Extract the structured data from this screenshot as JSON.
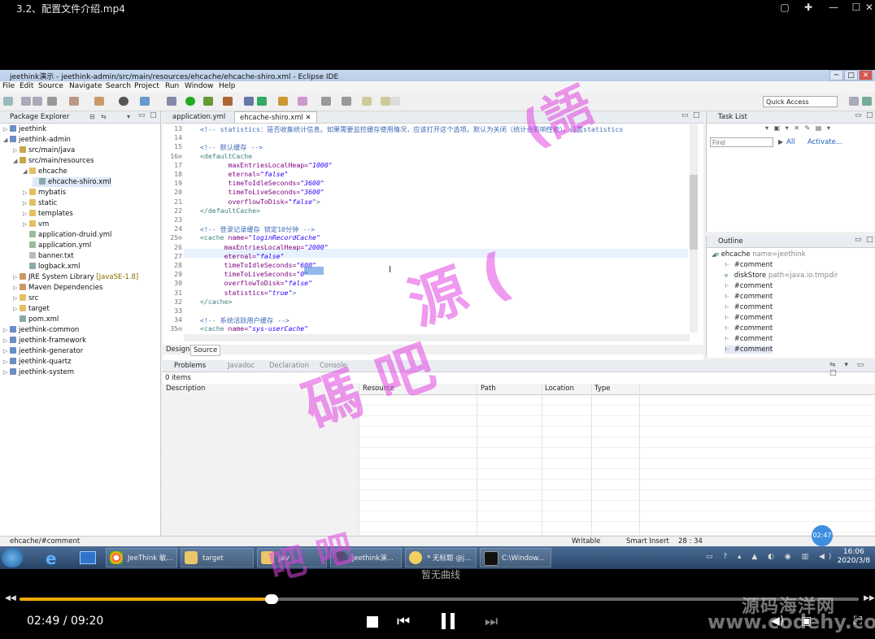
{
  "player": {
    "title": "3.2、配置文件介绍.mp4",
    "time": "02:49 / 09:20",
    "progress": 0.3,
    "subtitle_note": "暂无曲线",
    "badge_time": "02:47"
  },
  "eclipse": {
    "window_title": "jeethink演示 - jeethink-admin/src/main/resources/ehcache/ehcache-shiro.xml - Eclipse IDE",
    "menu": [
      "File",
      "Edit",
      "Source",
      "Navigate",
      "Search",
      "Project",
      "Run",
      "Window",
      "Help"
    ],
    "quick_access": "Quick Access",
    "package_explorer": {
      "title": "Package Explorer",
      "items": [
        {
          "label": "jeethink",
          "indent": 0,
          "twisty": "▷",
          "kind": "project"
        },
        {
          "label": "jeethink-admin",
          "indent": 0,
          "twisty": "◢",
          "kind": "project"
        },
        {
          "label": "src/main/java",
          "indent": 1,
          "twisty": "▷",
          "kind": "srcfolder"
        },
        {
          "label": "src/main/resources",
          "indent": 1,
          "twisty": "◢",
          "kind": "srcfolder"
        },
        {
          "label": "ehcache",
          "indent": 2,
          "twisty": "◢",
          "kind": "folder"
        },
        {
          "label": "ehcache-shiro.xml",
          "indent": 3,
          "twisty": "",
          "kind": "xml"
        },
        {
          "label": "mybatis",
          "indent": 2,
          "twisty": "▷",
          "kind": "folder"
        },
        {
          "label": "static",
          "indent": 2,
          "twisty": "▷",
          "kind": "folder"
        },
        {
          "label": "templates",
          "indent": 2,
          "twisty": "▷",
          "kind": "folder"
        },
        {
          "label": "vm",
          "indent": 2,
          "twisty": "▷",
          "kind": "folder"
        },
        {
          "label": "application-druid.yml",
          "indent": 2,
          "twisty": "",
          "kind": "yml"
        },
        {
          "label": "application.yml",
          "indent": 2,
          "twisty": "",
          "kind": "yml"
        },
        {
          "label": "banner.txt",
          "indent": 2,
          "twisty": "",
          "kind": "txt"
        },
        {
          "label": "logback.xml",
          "indent": 2,
          "twisty": "",
          "kind": "xml"
        },
        {
          "label": "JRE System Library",
          "suffix": " [JavaSE-1.8]",
          "indent": 1,
          "twisty": "▷",
          "kind": "lib"
        },
        {
          "label": "Maven Dependencies",
          "indent": 1,
          "twisty": "▷",
          "kind": "lib"
        },
        {
          "label": "src",
          "indent": 1,
          "twisty": "▷",
          "kind": "folder"
        },
        {
          "label": "target",
          "indent": 1,
          "twisty": "▷",
          "kind": "folder"
        },
        {
          "label": "pom.xml",
          "indent": 1,
          "twisty": "",
          "kind": "xml"
        },
        {
          "label": "jeethink-common",
          "indent": 0,
          "twisty": "▷",
          "kind": "project"
        },
        {
          "label": "jeethink-framework",
          "indent": 0,
          "twisty": "▷",
          "kind": "project"
        },
        {
          "label": "jeethink-generator",
          "indent": 0,
          "twisty": "▷",
          "kind": "project"
        },
        {
          "label": "jeethink-quartz",
          "indent": 0,
          "twisty": "▷",
          "kind": "project"
        },
        {
          "label": "jeethink-system",
          "indent": 0,
          "twisty": "▷",
          "kind": "project"
        }
      ]
    },
    "editor": {
      "tabs": [
        "application.yml",
        "ehcache-shiro.xml"
      ],
      "lines": [
        {
          "n": "13",
          "segs": [
            [
              "cm",
              "<!-- statistics：是否收集统计信息。如果需要监控缓存使用情况，应该打开这个选项。默认为关闭（统计会影响性能）。设置statistics"
            ]
          ]
        },
        {
          "n": "14",
          "segs": []
        },
        {
          "n": "15",
          "segs": [
            [
              "cm",
              "<!-- 默认缓存 -->"
            ]
          ]
        },
        {
          "n": "16⊖",
          "segs": [
            [
              "tg",
              "<defaultCache"
            ]
          ]
        },
        {
          "n": "17",
          "segs": [
            [
              "sp",
              "       "
            ],
            [
              "at",
              "maxEntriesLocalHeap="
            ],
            [
              "vl",
              "\"1000\""
            ]
          ]
        },
        {
          "n": "18",
          "segs": [
            [
              "sp",
              "       "
            ],
            [
              "at",
              "eternal="
            ],
            [
              "vl",
              "\"false\""
            ]
          ]
        },
        {
          "n": "19",
          "segs": [
            [
              "sp",
              "       "
            ],
            [
              "at",
              "timeToIdleSeconds="
            ],
            [
              "vl",
              "\"3600\""
            ]
          ]
        },
        {
          "n": "20",
          "segs": [
            [
              "sp",
              "       "
            ],
            [
              "at",
              "timeToLiveSeconds="
            ],
            [
              "vl",
              "\"3600\""
            ]
          ]
        },
        {
          "n": "21",
          "segs": [
            [
              "sp",
              "       "
            ],
            [
              "at",
              "overflowToDisk="
            ],
            [
              "vl",
              "\"false\""
            ],
            [
              "tg",
              ">"
            ]
          ]
        },
        {
          "n": "22",
          "segs": [
            [
              "tg",
              "</defaultCache>"
            ]
          ]
        },
        {
          "n": "23",
          "segs": []
        },
        {
          "n": "24",
          "segs": [
            [
              "cm",
              "<!-- 登录记录缓存 锁定10分钟 -->"
            ]
          ]
        },
        {
          "n": "25⊖",
          "segs": [
            [
              "tg",
              "<cache "
            ],
            [
              "at",
              "name="
            ],
            [
              "vl",
              "\"loginRecordCache\""
            ]
          ]
        },
        {
          "n": "26",
          "segs": [
            [
              "sp",
              "      "
            ],
            [
              "at",
              "maxEntriesLocalHeap="
            ],
            [
              "vl",
              "\"2000\""
            ]
          ]
        },
        {
          "n": "27",
          "segs": [
            [
              "sp",
              "      "
            ],
            [
              "at",
              "eternal="
            ],
            [
              "vl",
              "\"false\""
            ]
          ]
        },
        {
          "n": "28",
          "segs": [
            [
              "sp",
              "      "
            ],
            [
              "at",
              "timeToIdleSeconds="
            ],
            [
              "vl",
              "\"600\""
            ]
          ]
        },
        {
          "n": "29",
          "segs": [
            [
              "sp",
              "      "
            ],
            [
              "at",
              "timeToLiveSeconds="
            ],
            [
              "vl",
              "\"0\""
            ]
          ]
        },
        {
          "n": "30",
          "segs": [
            [
              "sp",
              "      "
            ],
            [
              "at",
              "overflowToDisk="
            ],
            [
              "vl",
              "\"false\""
            ]
          ]
        },
        {
          "n": "31",
          "segs": [
            [
              "sp",
              "      "
            ],
            [
              "at",
              "statistics="
            ],
            [
              "vl",
              "\"true\""
            ],
            [
              "tg",
              ">"
            ]
          ]
        },
        {
          "n": "32",
          "segs": [
            [
              "tg",
              "</cache>"
            ]
          ]
        },
        {
          "n": "33",
          "segs": []
        },
        {
          "n": "34",
          "segs": [
            [
              "cm",
              "<!-- 系统活跃用户缓存 -->"
            ]
          ]
        },
        {
          "n": "35⊖",
          "segs": [
            [
              "tg",
              "<cache "
            ],
            [
              "at",
              "name="
            ],
            [
              "vl",
              "\"sys-userCache\""
            ]
          ]
        }
      ],
      "bottom_tabs": [
        "Design",
        "Source"
      ]
    },
    "task_list": {
      "title": "Task List",
      "find_placeholder": "Find",
      "all": "All",
      "activate": "Activate..."
    },
    "outline": {
      "title": "Outline",
      "items": [
        {
          "label": "ehcache",
          "suffix": " name=jeethink",
          "indent": 0,
          "kind": "elem"
        },
        {
          "label": "#comment",
          "indent": 1,
          "kind": "cmt"
        },
        {
          "label": "diskStore",
          "suffix": " path=java.io.tmpdir",
          "indent": 1,
          "kind": "elem"
        },
        {
          "label": "#comment",
          "indent": 1,
          "kind": "cmt"
        },
        {
          "label": "#comment",
          "indent": 1,
          "kind": "cmt"
        },
        {
          "label": "#comment",
          "indent": 1,
          "kind": "cmt"
        },
        {
          "label": "#comment",
          "indent": 1,
          "kind": "cmt"
        },
        {
          "label": "#comment",
          "indent": 1,
          "kind": "cmt"
        },
        {
          "label": "#comment",
          "indent": 1,
          "kind": "cmt"
        },
        {
          "label": "#comment",
          "indent": 1,
          "kind": "cmt"
        }
      ]
    },
    "problems": {
      "tabs": [
        "Problems",
        "Javadoc",
        "Declaration",
        "Console"
      ],
      "count": "0 items",
      "columns": [
        "Description",
        "Resource",
        "Path",
        "Location",
        "Type"
      ]
    },
    "status": {
      "path": "ehcache/#comment",
      "writable": "Writable",
      "insert": "Smart Insert",
      "pos": "28 : 34"
    }
  },
  "taskbar": {
    "tasks": [
      "JeeThink 敏...",
      "target",
      "jav",
      "jeethink演...",
      "* 无标题 @j...",
      "C:\\Window..."
    ],
    "time": "16:06",
    "date": "2020/3/8"
  },
  "watermark": {
    "site": "源码海洋网",
    "url": "www.codehy.com"
  }
}
